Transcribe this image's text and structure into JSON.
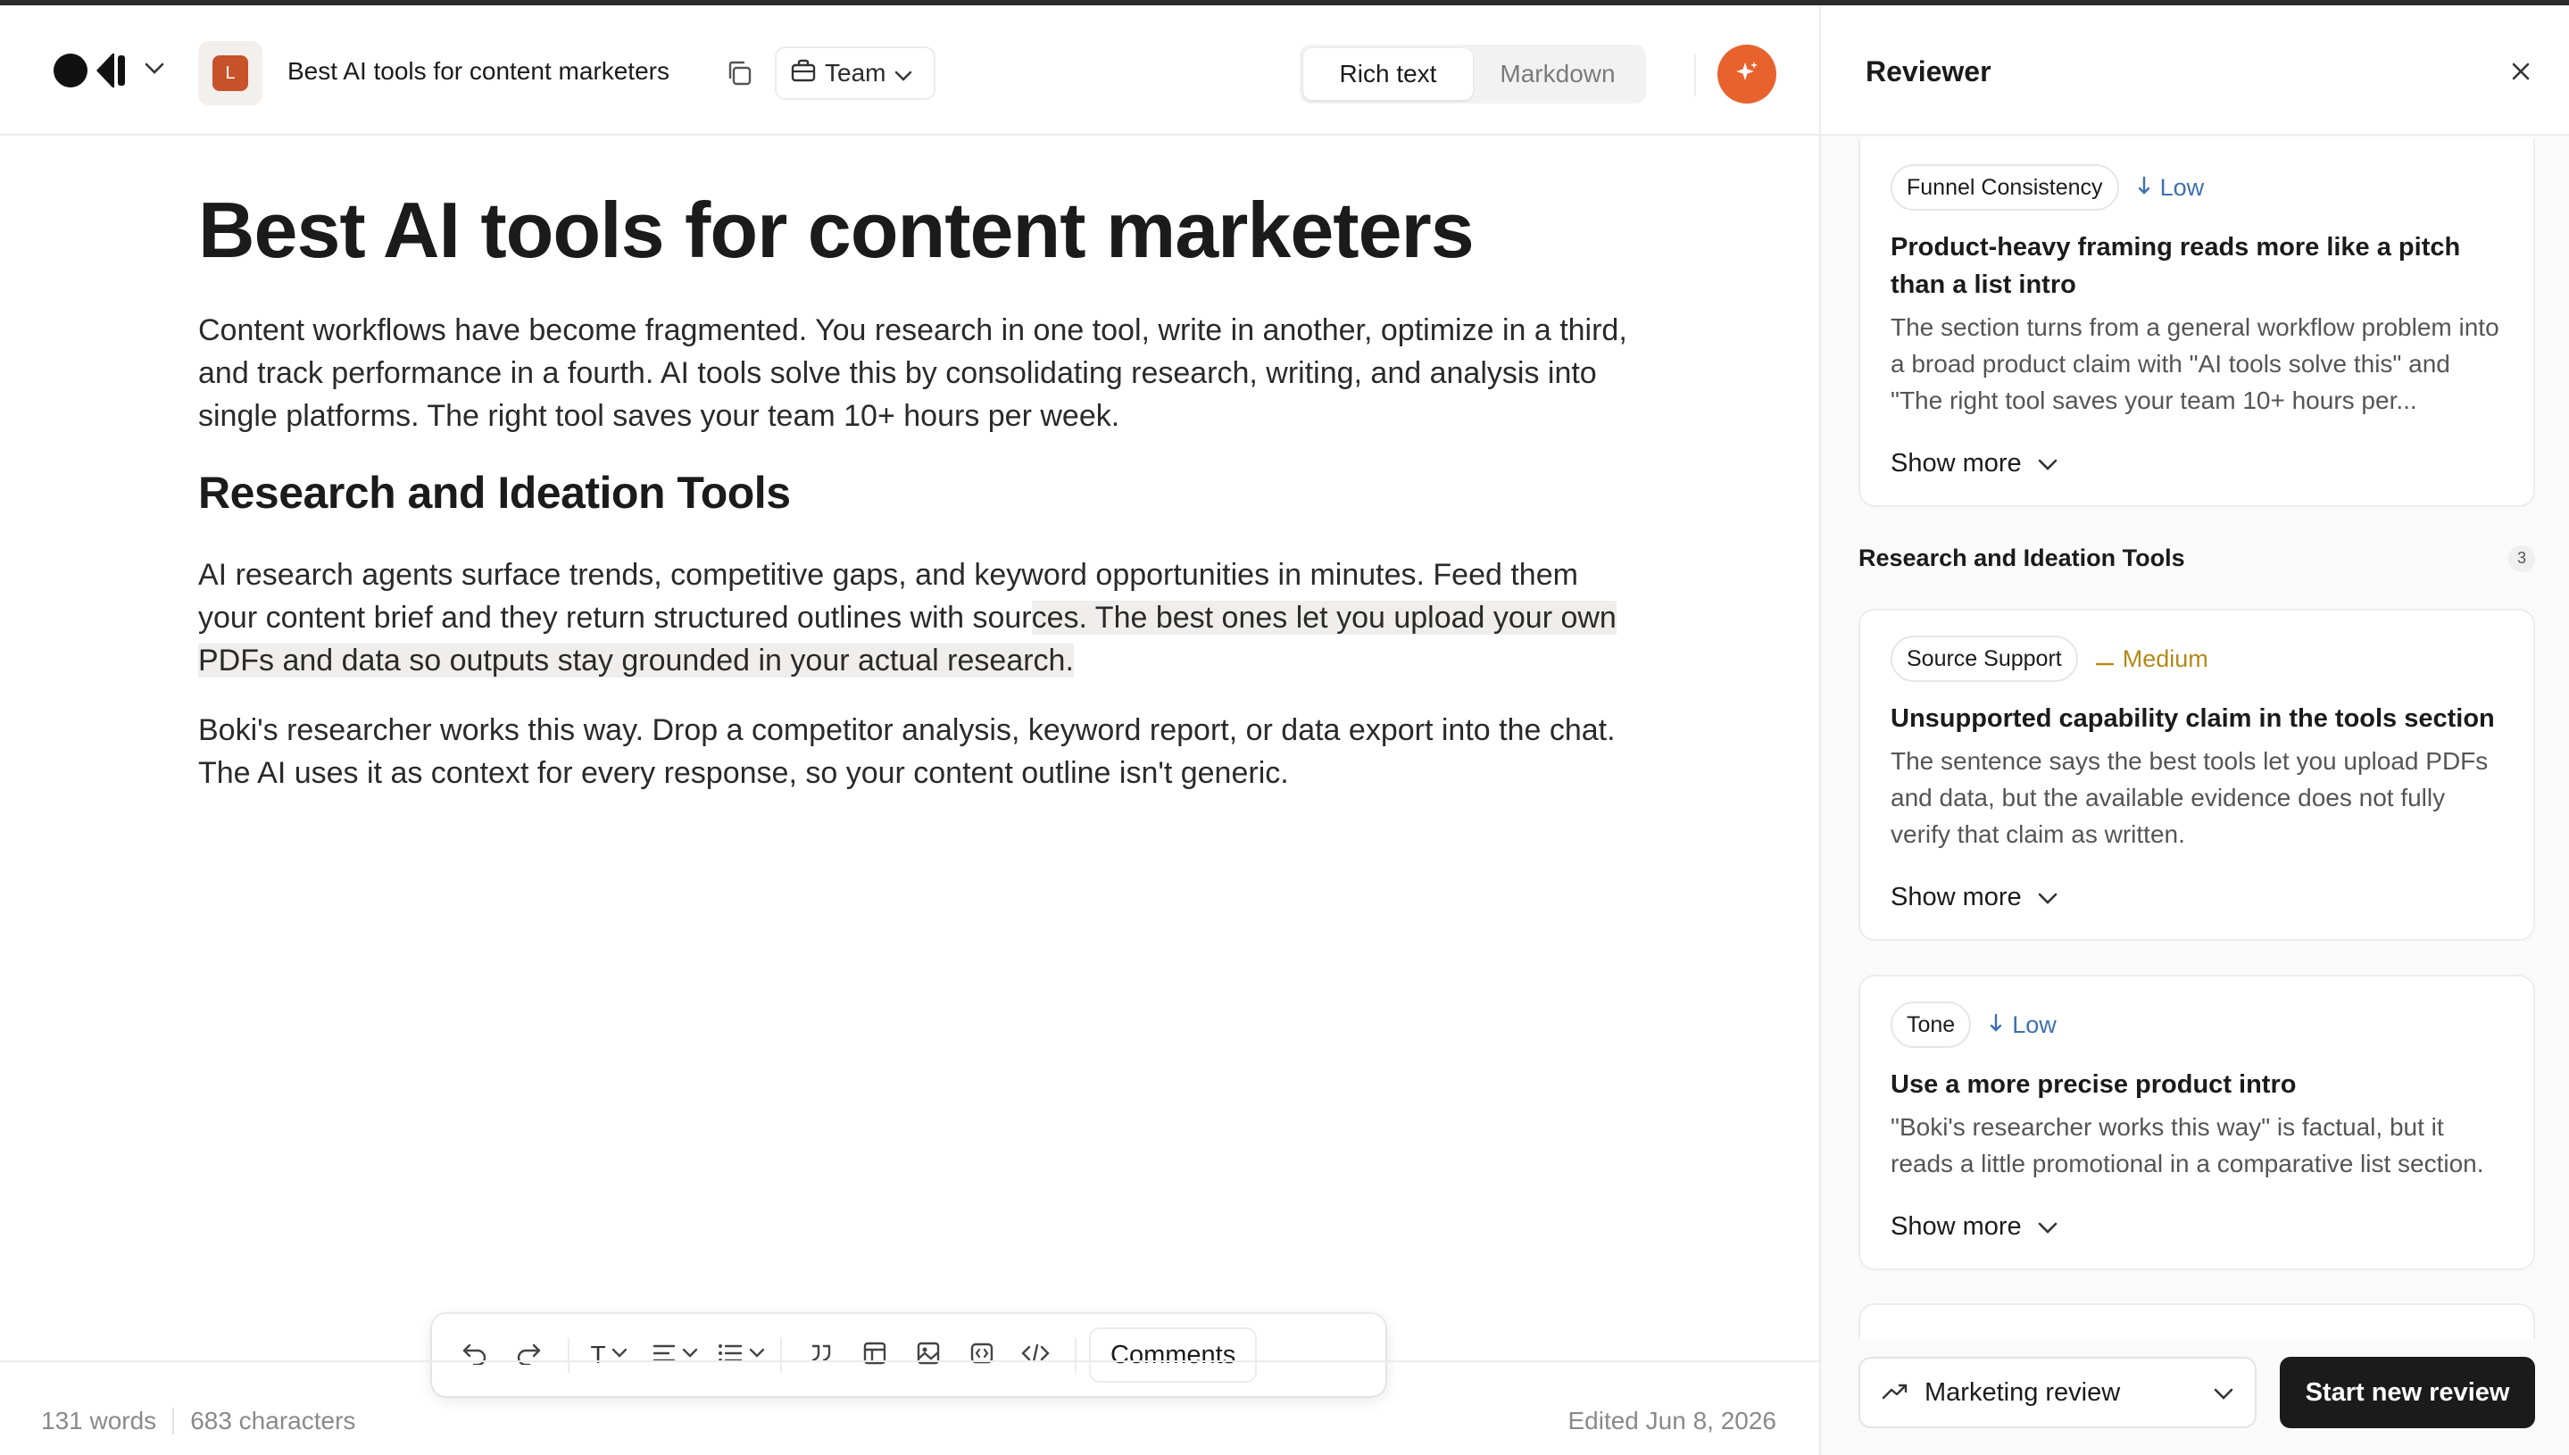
{
  "document": {
    "title": "Best AI tools for content marketers",
    "badge_letter": "L",
    "team_label": "Team",
    "view_modes": [
      "Rich text",
      "Markdown"
    ],
    "active_view": "Rich text"
  },
  "content": {
    "heading": "Best AI tools for content marketers",
    "intro": "Content workflows have become fragmented. You research in one tool, write in another, optimize in a third, and track performance in a fourth. AI tools solve this by consolidating research, writing, and analysis into single platforms. The right tool saves your team 10+ hours per week.",
    "section_heading": "Research and Ideation Tools",
    "para2_a": "AI research agents surface trends, competitive gaps, and keyword opportunities in minutes. Feed them your content brief and they return structured outlines with sour",
    "para2_b": "ces. The best ones let you upload your own PDFs and data so outputs stay grounded in your actual research.",
    "para3": "Boki's researcher works this way. Drop a competitor analysis, keyword report, or data export into the chat. The AI uses it as context for every response, so your content outline isn't generic."
  },
  "toolbar": {
    "comments_label": "Comments",
    "text_style_label": "T"
  },
  "footer": {
    "words": "131 words",
    "characters": "683 characters",
    "edited": "Edited Jun 8, 2026"
  },
  "reviewer": {
    "title": "Reviewer",
    "cards": [
      {
        "tag": "Funnel Consistency",
        "severity": "Low",
        "title": "Product-heavy framing reads more like a pitch than a list intro",
        "body": "The section turns from a general workflow problem into a broad product claim with \"AI tools solve this\" and \"The right tool saves your team 10+ hours per...",
        "show_more": "Show more"
      },
      {
        "tag": "Source Support",
        "severity": "Medium",
        "title": "Unsupported capability claim in the tools section",
        "body": "The sentence says the best tools let you upload PDFs and data, but the available evidence does not fully verify that claim as written.",
        "show_more": "Show more"
      },
      {
        "tag": "Tone",
        "severity": "Low",
        "title": "Use a more precise product intro",
        "body": "\"Boki's researcher works this way\" is factual, but it reads a little promotional in a comparative list section.",
        "show_more": "Show more"
      }
    ],
    "group": {
      "title": "Research and Ideation Tools",
      "count": "3"
    },
    "review_type": "Marketing review",
    "start_label": "Start new review"
  },
  "colors": {
    "accent": "#e8622d",
    "badge": "#c8522a",
    "low": "#3e6fb0",
    "medium": "#b38a17"
  }
}
